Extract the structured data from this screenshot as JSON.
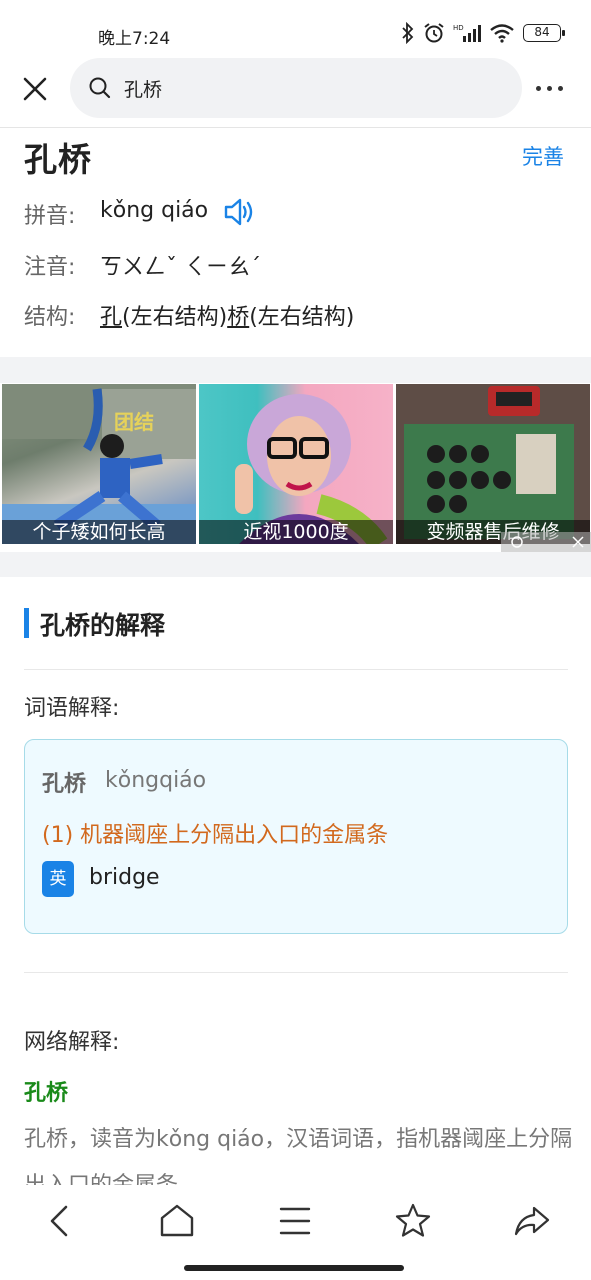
{
  "status_bar": {
    "time": "晚上7:24",
    "battery": "84"
  },
  "search": {
    "query": "孔桥"
  },
  "word": {
    "title": "孔桥",
    "edit_label": "完善",
    "pinyin_label": "拼音:",
    "pinyin": "kǒng qiáo",
    "zhuyin_label": "注音:",
    "zhuyin": "ㄎㄨㄥˇ ㄑㄧㄠˊ",
    "structure_label": "结构:",
    "structure": {
      "char1": "孔",
      "struct1": "(左右结构)",
      "char2": "桥",
      "struct2": "(左右结构)"
    }
  },
  "ads": [
    {
      "caption": "个子矮如何长高"
    },
    {
      "caption": "近视1000度"
    },
    {
      "caption": "变频器售后维修"
    }
  ],
  "section": {
    "title": "孔桥的解释"
  },
  "definition": {
    "label": "词语解释:",
    "word": "孔桥",
    "pinyin": "kǒngqiáo",
    "meaning": "(1) 机器阈座上分隔出入口的金属条",
    "en_badge": "英",
    "english": "bridge"
  },
  "net": {
    "label": "网络解释:",
    "word": "孔桥",
    "text": "孔桥，读音为kǒng qiáo，汉语词语，指机器阈座上分隔出入口的金属条。"
  },
  "colors": {
    "accent": "#1a83e6",
    "definition": "#d2691e",
    "net_word": "#1a8a1a"
  }
}
